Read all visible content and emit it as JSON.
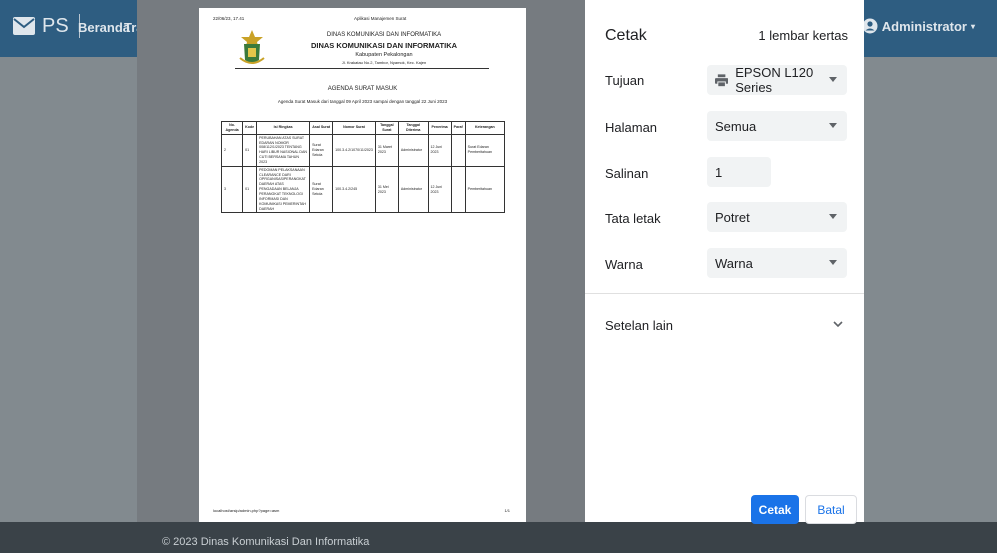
{
  "app": {
    "brand": "PS",
    "nav": [
      "Beranda",
      "Tra"
    ],
    "user": "Administrator",
    "footer": "© 2023 Dinas Komunikasi Dan Informatika"
  },
  "preview": {
    "timestamp": "22/06/23, 17.41",
    "app_name": "Aplikasi Manajemen Surat",
    "letterhead": {
      "line1": "DINAS KOMUNIKASI DAN INFORMATIKA",
      "line2": "DINAS KOMUNIKASI DAN INFORMATIKA",
      "line3": "Kabupaten Pekalongan",
      "line4": "Jl. Krakatau No.2, Tambor, Nyamok, Kec. Kajen"
    },
    "agenda_title": "AGENDA SURAT MASUK",
    "agenda_sub": "Agenda Surat Masuk dari tanggal 09 April 2023 sampai dengan tanggal 22 Juni 2023",
    "table": {
      "headers": [
        "No. Agenda",
        "Kode",
        "Isi Ringkas",
        "Asal Surat",
        "Nomor Surat",
        "Tanggal Surat",
        "Tanggal Diterima",
        "Penerima",
        "Paraf",
        "Keterangan"
      ],
      "rows": [
        [
          "2",
          "01",
          "PERUBAHAN ATAS SURAT EDARAN NOMOR 008/112/1/2023 TENTANG HARI LIBUR NASIONAL DAN CUTI BERSAMA TAHUN 2023",
          "Surat Edaran Sekda",
          "100.3.4.2/1070/11/2023",
          "31 Maret 2023",
          "Administrator",
          "12 Juni 2023",
          "",
          "Surat Edaran Pemberitahuan"
        ],
        [
          "3",
          "01",
          "PEDOMAN PELAKSANAAN CLEARANCE DARI OPRGANISASIPERANGKAT DAERAH ATAS PENGADAAN BELANJA PERANGKAT TEKNOLOGI INFORMASI DAN KOMUNIKASI PEMERINTAH DAERAH",
          "Surat Edaran Sekda",
          "100.3.4.2/245",
          "31 Mei 2023",
          "Administrator",
          "12 Juni 2023",
          "",
          "Pemberitahuan"
        ]
      ]
    },
    "footer_url": "localhost/arsip/admin.php?page=asm",
    "page_num": "1/1"
  },
  "print": {
    "title": "Cetak",
    "sheets": "1 lembar kertas",
    "destination_label": "Tujuan",
    "destination_value": "EPSON L120 Series",
    "pages_label": "Halaman",
    "pages_value": "Semua",
    "copies_label": "Salinan",
    "copies_value": "1",
    "layout_label": "Tata letak",
    "layout_value": "Potret",
    "color_label": "Warna",
    "color_value": "Warna",
    "more_settings": "Setelan lain",
    "print_button": "Cetak",
    "cancel_button": "Batal",
    "accent": "#1a73e8"
  },
  "icons": {
    "brand": "mail-icon",
    "user": "user-circle-icon",
    "printer": "printer-icon",
    "caret": "caret-down-icon",
    "chevron": "chevron-down-icon"
  }
}
